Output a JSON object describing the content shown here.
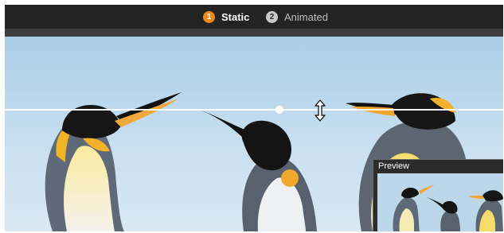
{
  "steps": [
    {
      "number": "1",
      "label": "Static",
      "active": true
    },
    {
      "number": "2",
      "label": "Animated",
      "active": false
    }
  ],
  "preview": {
    "title": "Preview"
  },
  "image": {
    "subject": "penguins-photo"
  },
  "colors": {
    "topbar": "#232323",
    "active_step": "#ef8a1a",
    "inactive_step": "#c9c9c9",
    "sky": "#b9d6ea"
  },
  "cursor": {
    "icon": "resize-vertical-icon"
  }
}
